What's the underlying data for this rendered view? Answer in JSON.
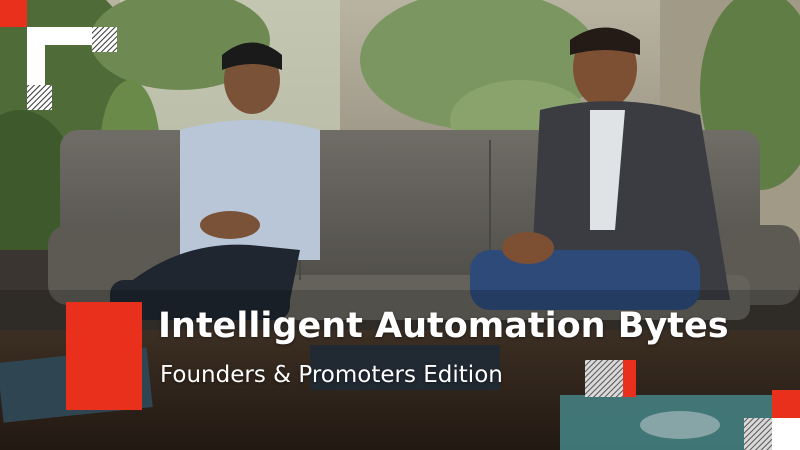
{
  "overlay": {
    "title": "Intelligent Automation Bytes",
    "subtitle": "Founders & Promoters Edition",
    "accent_color": "#e8301c",
    "text_color": "#ffffff"
  },
  "scene": {
    "description_icons": [
      "sofa-icon",
      "person-left-icon",
      "person-right-icon",
      "plants-icon",
      "coffee-table-icon"
    ]
  }
}
